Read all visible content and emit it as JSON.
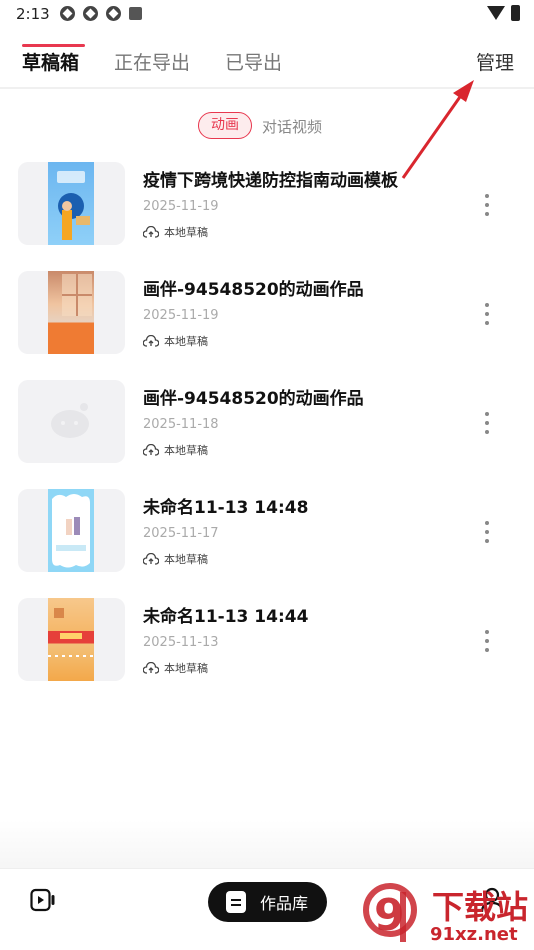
{
  "status_bar": {
    "time": "2:13"
  },
  "tabs": [
    {
      "label": "草稿箱",
      "active": true
    },
    {
      "label": "正在导出",
      "active": false
    },
    {
      "label": "已导出",
      "active": false
    }
  ],
  "manage_label": "管理",
  "subtabs": {
    "selected": "动画",
    "other": "对话视频"
  },
  "drafts": [
    {
      "title": "疫情下跨境快递防控指南动画模板",
      "date": "2025-11-19",
      "tag": "本地草稿"
    },
    {
      "title": "画伴-94548520的动画作品",
      "date": "2025-11-19",
      "tag": "本地草稿"
    },
    {
      "title": "画伴-94548520的动画作品",
      "date": "2025-11-18",
      "tag": "本地草稿"
    },
    {
      "title": "未命名11-13 14:48",
      "date": "2025-11-17",
      "tag": "本地草稿"
    },
    {
      "title": "未命名11-13 14:44",
      "date": "2025-11-13",
      "tag": "本地草稿"
    }
  ],
  "bottom_nav": {
    "center_label": "作品库"
  },
  "watermark": {
    "big": "下载站",
    "small": "91xz.net"
  },
  "colors": {
    "accent": "#e8384f",
    "annotation_arrow": "#d9262e",
    "watermark": "#c9252d"
  },
  "icons": [
    "video-camera-icon",
    "document-icon",
    "profile-icon",
    "cloud-upload-icon",
    "more-vertical-icon"
  ]
}
